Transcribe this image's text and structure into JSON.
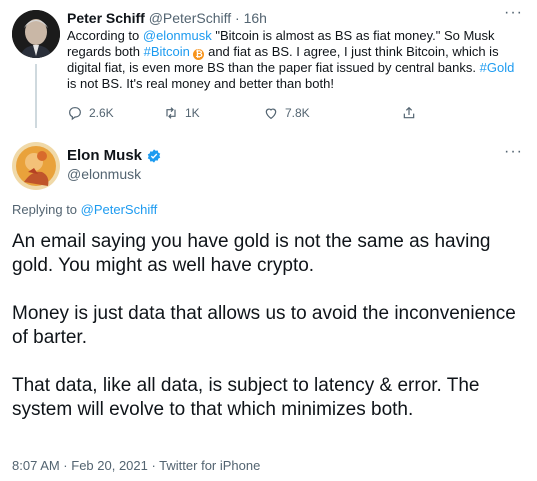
{
  "parent_tweet": {
    "display_name": "Peter Schiff",
    "handle": "@PeterSchiff",
    "separator": "·",
    "time": "16h",
    "more": "···",
    "body": {
      "part1": "According to ",
      "mention": "@elonmusk",
      "part2": " \"Bitcoin is almost as BS as fiat money.\" So Musk regards both ",
      "hashtag1": "#Bitcoin",
      "part3": " and fiat as BS. I agree, I just think Bitcoin, which is digital fiat, is even more BS than the paper fiat issued by central banks. ",
      "hashtag2": "#Gold",
      "part4": " is not BS. It's real money and better than both!"
    },
    "actions": {
      "reply_count": "2.6K",
      "retweet_count": "1K",
      "like_count": "7.8K"
    }
  },
  "main_tweet": {
    "display_name": "Elon Musk",
    "handle": "@elonmusk",
    "more": "···",
    "replying_prefix": "Replying to ",
    "replying_to": "@PeterSchiff",
    "paragraphs": [
      "An email saying you have gold is not the same as having gold. You might as well have crypto.",
      "Money is just data that allows us to avoid the inconvenience of barter.",
      "That data, like all data, is subject to latency & error. The system will evolve to that which minimizes both."
    ],
    "timestamp": "8:07 AM · Feb 20, 2021 · Twitter for iPhone"
  },
  "colors": {
    "accent": "#1d9bf0",
    "muted": "#536471",
    "text": "#0f1419",
    "bitcoin": "#f7931a"
  },
  "icons": [
    "reply-icon",
    "retweet-icon",
    "like-icon",
    "share-icon",
    "verified-icon",
    "bitcoin-icon",
    "more-icon"
  ]
}
